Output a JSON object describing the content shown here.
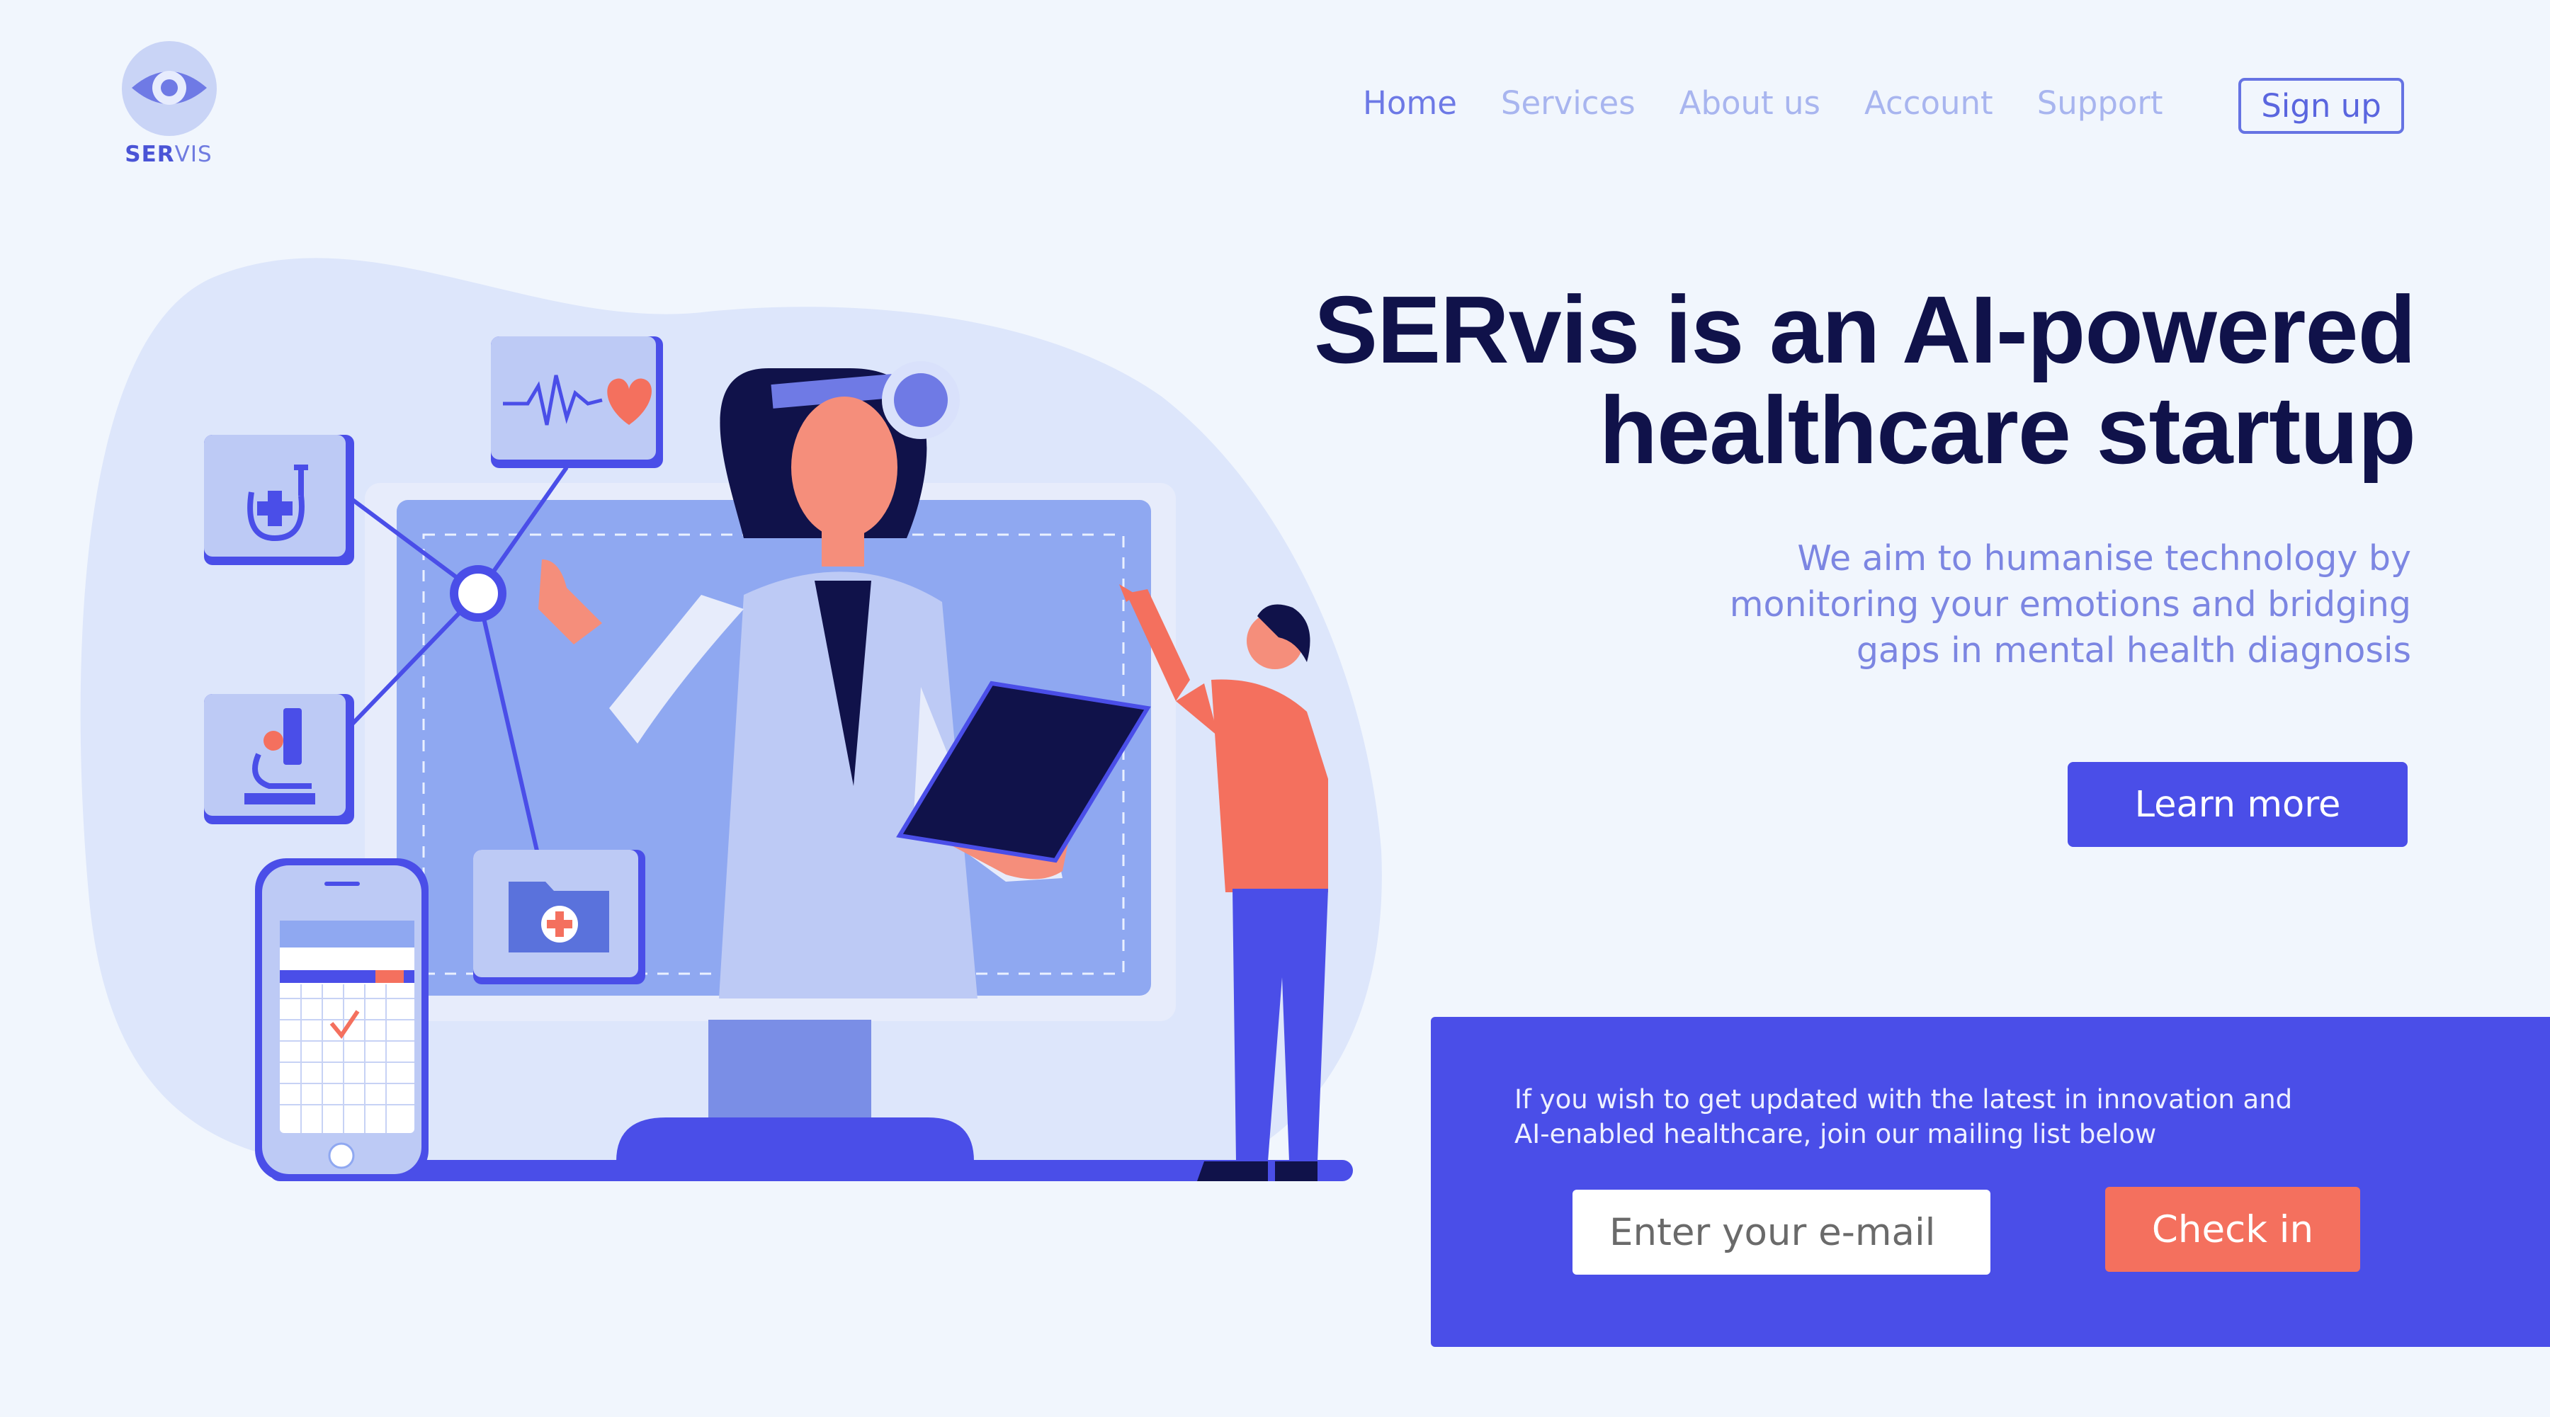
{
  "brand": {
    "logo_prefix": "SER",
    "logo_suffix": "VIS",
    "logo_icon": "eye-icon"
  },
  "nav": {
    "items": [
      {
        "label": "Home",
        "active": true
      },
      {
        "label": "Services",
        "active": false
      },
      {
        "label": "About us",
        "active": false
      },
      {
        "label": "Account",
        "active": false
      },
      {
        "label": "Support",
        "active": false
      }
    ],
    "signup_label": "Sign up"
  },
  "hero": {
    "title_line1": "SERvis is an AI-powered",
    "title_line2": "healthcare startup",
    "subtitle_line1": "We aim to humanise technology by",
    "subtitle_line2": "monitoring your emotions and bridging",
    "subtitle_line3": "gaps in mental health diagnosis",
    "cta_label": "Learn more"
  },
  "newsletter": {
    "text_line1": "If you wish to get updated with the latest in innovation and",
    "text_line2": "AI-enabled healthcare, join our mailing list below",
    "email_placeholder": "Enter your e-mail",
    "submit_label": "Check in"
  },
  "illustration": {
    "icons": [
      "stethoscope-icon",
      "heartbeat-icon",
      "microscope-icon",
      "medical-folder-icon",
      "calendar-phone-icon"
    ]
  },
  "colors": {
    "background": "#f1f6fd",
    "primary": "#4a4ee8",
    "accent": "#f4705e",
    "title": "#10124a",
    "subtitle": "#7c86e2",
    "nav": "#a8b5ef",
    "nav_active": "#6d79e6"
  }
}
